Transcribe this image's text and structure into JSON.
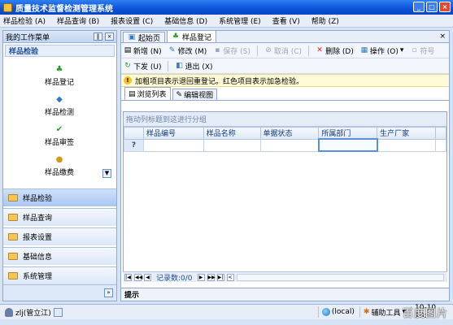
{
  "window": {
    "title": "质量技术监督检测管理系统"
  },
  "menu": [
    "样品检验 (A)",
    "样品查询 (B)",
    "报表设置 (C)",
    "基础信息 (D)",
    "系统管理 (E)",
    "查看 (V)",
    "帮助 (Z)"
  ],
  "left": {
    "header": "我的工作菜单",
    "section": "样品检验",
    "items": [
      "样品登记",
      "样品检测",
      "样品审签",
      "样品缴费"
    ],
    "nav": [
      "样品检验",
      "样品查询",
      "报表设置",
      "基础信息",
      "系统管理"
    ]
  },
  "tabs": [
    "起始页",
    "样品登记"
  ],
  "toolbar": {
    "row1": [
      "新增 (N)",
      "修改 (M)",
      "保存 (S)",
      "取消 (C)",
      "删除 (D)",
      "操作 (O)",
      "符号"
    ],
    "row2": [
      "下发 (U)",
      "退出 (X)"
    ]
  },
  "notice": "加粗项目表示退回重登记。红色项目表示加急检验。",
  "subtabs": [
    "浏览列表",
    "编辑视图"
  ],
  "grid": {
    "group_hint": "拖动列标题到这进行分组",
    "columns": [
      "样品编号",
      "样品名称",
      "单据状态",
      "所属部门",
      "生产厂家"
    ],
    "row_indicator": "?"
  },
  "pager": {
    "records": "记录数:0/0"
  },
  "hint": "提示",
  "status": {
    "user": "zlj(管立江)",
    "server": "(local)",
    "tools": "辅助工具",
    "date": "10-10 18:"
  },
  "watermark": "百度图片"
}
